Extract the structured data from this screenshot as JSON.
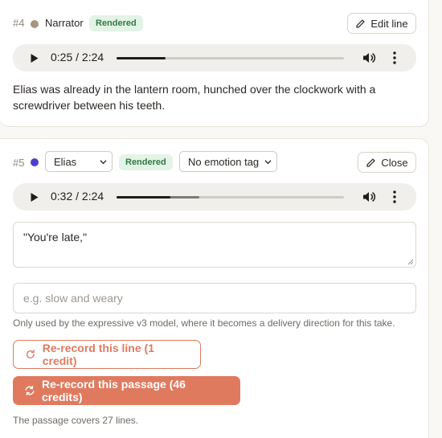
{
  "colors": {
    "accent": "#e07a5f",
    "rendered_badge_bg": "#e3f3e6",
    "rendered_badge_text": "#2f7a45",
    "narrator_dot": "#a89580",
    "elias_dot": "#4a3fc9"
  },
  "line4": {
    "number": "#4",
    "speaker": "Narrator",
    "status": "Rendered",
    "edit_label": "Edit line",
    "player": {
      "time": "0:25 / 2:24",
      "progress": 0.215
    },
    "text": "Elias was already in the lantern room, hunched over the clockwork with a screwdriver between his teeth."
  },
  "line5": {
    "number": "#5",
    "speaker_select": "Elias",
    "status": "Rendered",
    "emotion_select": "No emotion tag",
    "close_label": "Close",
    "player": {
      "time": "0:32 / 2:24",
      "progress": 0.235,
      "buffered": 0.365
    },
    "text_value": "\"You're late,\"",
    "direction_placeholder": "e.g. slow and weary",
    "direction_hint": "Only used by the expressive v3 model, where it becomes a delivery direction for this take.",
    "rerecord_line_label": "Re-record this line (1 credit)",
    "rerecord_passage_label": "Re-record this passage (46 credits)",
    "footer": "The passage covers 27 lines."
  }
}
